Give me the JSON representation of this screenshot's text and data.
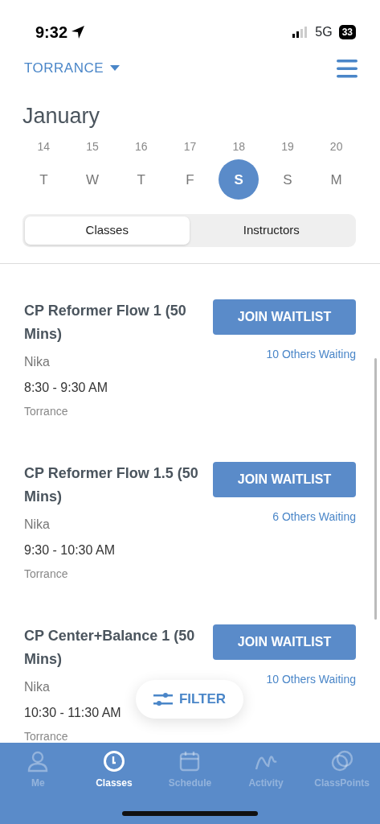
{
  "status_bar": {
    "time": "9:32",
    "network": "5G",
    "battery": "33"
  },
  "location": {
    "label": "TORRANCE"
  },
  "month": "January",
  "days": [
    {
      "date": "14",
      "weekday": "T",
      "selected": false
    },
    {
      "date": "15",
      "weekday": "W",
      "selected": false
    },
    {
      "date": "16",
      "weekday": "T",
      "selected": false
    },
    {
      "date": "17",
      "weekday": "F",
      "selected": false
    },
    {
      "date": "18",
      "weekday": "S",
      "selected": true
    },
    {
      "date": "19",
      "weekday": "S",
      "selected": false
    },
    {
      "date": "20",
      "weekday": "M",
      "selected": false
    }
  ],
  "tabs": [
    {
      "label": "Classes",
      "selected": true
    },
    {
      "label": "Instructors",
      "selected": false
    }
  ],
  "classes": [
    {
      "title": "CP Reformer Flow 1 (50 Mins)",
      "instructor": "Nika",
      "time": "8:30 - 9:30 AM",
      "location": "Torrance",
      "button": "JOIN WAITLIST",
      "waiting": "10 Others Waiting"
    },
    {
      "title": "CP Reformer Flow 1.5 (50 Mins)",
      "instructor": "Nika",
      "time": "9:30 - 10:30 AM",
      "location": "Torrance",
      "button": "JOIN WAITLIST",
      "waiting": "6 Others Waiting"
    },
    {
      "title": "CP Center+Balance 1 (50 Mins)",
      "instructor": "Nika",
      "time": "10:30 - 11:30 AM",
      "location": "Torrance",
      "button": "JOIN WAITLIST",
      "waiting": "10 Others Waiting"
    }
  ],
  "filter": {
    "label": "FILTER"
  },
  "nav": [
    {
      "label": "Me",
      "kind": "person",
      "selected": false
    },
    {
      "label": "Classes",
      "kind": "clock",
      "selected": true
    },
    {
      "label": "Schedule",
      "kind": "calendar",
      "selected": false
    },
    {
      "label": "Activity",
      "kind": "wave",
      "selected": false
    },
    {
      "label": "ClassPoints",
      "kind": "circles",
      "selected": false
    }
  ]
}
